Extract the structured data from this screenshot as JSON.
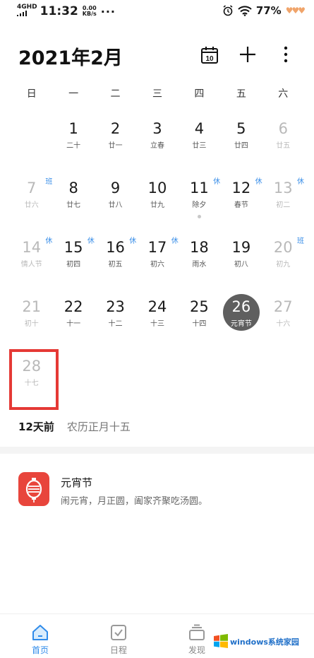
{
  "status_bar": {
    "network": "4GHD",
    "time": "11:32",
    "speed_value": "0.00",
    "speed_unit": "KB/s",
    "dots": "···",
    "battery": "77%",
    "hearts": "♥♥♥"
  },
  "header": {
    "title": "2021年2月",
    "today_number": "10"
  },
  "weekdays": [
    "日",
    "一",
    "二",
    "三",
    "四",
    "五",
    "六"
  ],
  "days": [
    {
      "num": "1",
      "lunar": "二十",
      "tag": "",
      "other": false
    },
    {
      "num": "2",
      "lunar": "廿一",
      "tag": "",
      "other": false
    },
    {
      "num": "3",
      "lunar": "立春",
      "tag": "",
      "other": false
    },
    {
      "num": "4",
      "lunar": "廿三",
      "tag": "",
      "other": false
    },
    {
      "num": "5",
      "lunar": "廿四",
      "tag": "",
      "other": false
    },
    {
      "num": "6",
      "lunar": "廿五",
      "tag": "",
      "other": true
    },
    {
      "num": "7",
      "lunar": "廿六",
      "tag": "班",
      "other": true
    },
    {
      "num": "8",
      "lunar": "廿七",
      "tag": "",
      "other": false
    },
    {
      "num": "9",
      "lunar": "廿八",
      "tag": "",
      "other": false
    },
    {
      "num": "10",
      "lunar": "廿九",
      "tag": "",
      "other": false
    },
    {
      "num": "11",
      "lunar": "除夕",
      "tag": "休",
      "other": false,
      "has_event": true
    },
    {
      "num": "12",
      "lunar": "春节",
      "tag": "休",
      "other": false
    },
    {
      "num": "13",
      "lunar": "初二",
      "tag": "休",
      "other": true
    },
    {
      "num": "14",
      "lunar": "情人节",
      "tag": "休",
      "other": true
    },
    {
      "num": "15",
      "lunar": "初四",
      "tag": "休",
      "other": false
    },
    {
      "num": "16",
      "lunar": "初五",
      "tag": "休",
      "other": false
    },
    {
      "num": "17",
      "lunar": "初六",
      "tag": "休",
      "other": false
    },
    {
      "num": "18",
      "lunar": "雨水",
      "tag": "",
      "other": false
    },
    {
      "num": "19",
      "lunar": "初八",
      "tag": "",
      "other": false
    },
    {
      "num": "20",
      "lunar": "初九",
      "tag": "班",
      "other": true
    },
    {
      "num": "21",
      "lunar": "初十",
      "tag": "",
      "other": true
    },
    {
      "num": "22",
      "lunar": "十一",
      "tag": "",
      "other": false
    },
    {
      "num": "23",
      "lunar": "十二",
      "tag": "",
      "other": false
    },
    {
      "num": "24",
      "lunar": "十三",
      "tag": "",
      "other": false
    },
    {
      "num": "25",
      "lunar": "十四",
      "tag": "",
      "other": false
    },
    {
      "num": "26",
      "lunar": "元宵节",
      "tag": "",
      "other": false,
      "selected": true
    },
    {
      "num": "27",
      "lunar": "十六",
      "tag": "",
      "other": true
    },
    {
      "num": "28",
      "lunar": "十七",
      "tag": "",
      "other": true,
      "highlighted": true
    }
  ],
  "info": {
    "days_ago": "12天前",
    "lunar_date": "农历正月十五"
  },
  "event": {
    "title": "元宵节",
    "description": "闹元宵，月正圆，阖家齐聚吃汤圆。"
  },
  "bottom_nav": [
    {
      "label": "首页",
      "icon": "home-icon",
      "active": true
    },
    {
      "label": "日程",
      "icon": "checkbox-icon",
      "active": false
    },
    {
      "label": "发现",
      "icon": "layers-icon",
      "active": false
    }
  ],
  "watermark": "windows系统家园",
  "colors": {
    "accent": "#2f8bea",
    "tag_blue": "#3b8fe8",
    "selected_circle": "#5f5f5f",
    "highlight_red": "#e53935",
    "event_red": "#e8453c"
  }
}
